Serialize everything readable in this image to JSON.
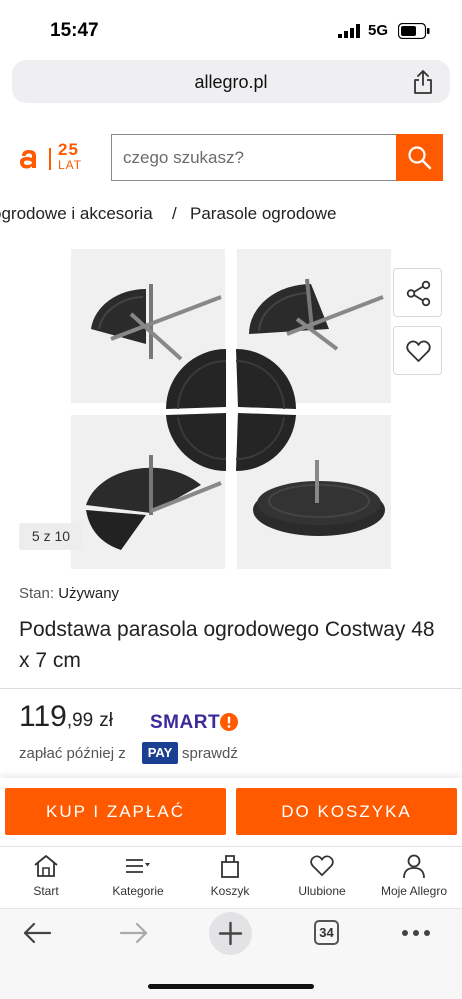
{
  "status_bar": {
    "time": "15:47",
    "network": "5G"
  },
  "browser": {
    "url": "allegro.pl",
    "tabs_count": "34"
  },
  "header": {
    "logo_years": "25",
    "logo_word": "LAT",
    "search_placeholder": "czego szukasz?"
  },
  "breadcrumb": {
    "items": [
      "ogrodowe i akcesoria",
      "Parasole ogrodowe"
    ],
    "separator": "/"
  },
  "gallery": {
    "counter": "5 z 10"
  },
  "product": {
    "condition_label": "Stan:",
    "condition_value": "Używany",
    "title": "Podstawa parasola ogrodowego Costway 48 x 7 cm",
    "price_int": "119",
    "price_dec": ",99",
    "currency": "zł",
    "smart_label": "SMART",
    "paylater_text": "zapłać później z",
    "pay_badge": "PAY",
    "paylater_action": "sprawdź"
  },
  "actions": {
    "buy": "KUP I ZAPŁAĆ",
    "cart": "DO KOSZYKA"
  },
  "nav": [
    {
      "label": "Start",
      "icon": "home-icon"
    },
    {
      "label": "Kategorie",
      "icon": "menu-icon"
    },
    {
      "label": "Koszyk",
      "icon": "bag-icon"
    },
    {
      "label": "Ulubione",
      "icon": "heart-icon"
    },
    {
      "label": "Moje Allegro",
      "icon": "user-icon"
    }
  ],
  "colors": {
    "accent": "#ff5a00",
    "smart": "#3b2a9a",
    "pay": "#1b3f91"
  }
}
